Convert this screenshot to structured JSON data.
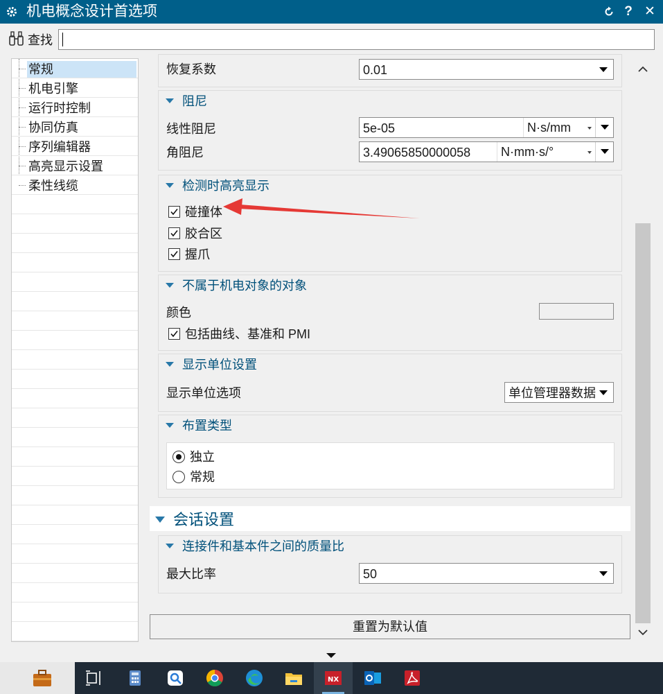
{
  "window": {
    "title": "机电概念设计首选项",
    "icons": [
      "gear-icon",
      "reset-icon",
      "help-icon",
      "close-icon"
    ],
    "help_label": "?",
    "close_label": "✕"
  },
  "search": {
    "label": "查找",
    "value": ""
  },
  "tree": {
    "items": [
      {
        "label": "常规",
        "selected": true
      },
      {
        "label": "机电引擎"
      },
      {
        "label": "运行时控制"
      },
      {
        "label": "协同仿真"
      },
      {
        "label": "序列编辑器"
      },
      {
        "label": "高亮显示设置"
      },
      {
        "label": "柔性线缆"
      }
    ]
  },
  "general": {
    "restitution": {
      "label": "恢复系数",
      "value": "0.01"
    },
    "damping": {
      "title": "阻尼",
      "linear": {
        "label": "线性阻尼",
        "value": "5e-05",
        "unit": "N·s/mm"
      },
      "angular": {
        "label": "角阻尼",
        "value": "3.49065850000058",
        "unit": "N·mm·s/°"
      }
    },
    "highlight": {
      "title": "检测时高亮显示",
      "items": [
        {
          "label": "碰撞体",
          "checked": true
        },
        {
          "label": "胶合区",
          "checked": true
        },
        {
          "label": "握爪",
          "checked": true
        }
      ]
    },
    "non_mechatronic": {
      "title": "不属于机电对象的对象",
      "color_label": "颜色",
      "include_label": "包括曲线、基准和 PMI",
      "include_checked": true
    },
    "unit_settings": {
      "title": "显示单位设置",
      "option_label": "显示单位选项",
      "option_value": "单位管理器数据"
    },
    "layout": {
      "title": "布置类型",
      "options": [
        {
          "label": "独立",
          "selected": true
        },
        {
          "label": "常规",
          "selected": false
        }
      ]
    }
  },
  "session": {
    "title": "会话设置",
    "mass_ratio": {
      "title": "连接件和基本件之间的质量比",
      "max_label": "最大比率",
      "max_value": "50"
    }
  },
  "buttons": {
    "reset": "重置为默认值"
  },
  "taskbar": {
    "apps": [
      "briefcase-icon",
      "task-view-icon",
      "calculator-icon",
      "snipping-icon",
      "chrome-icon",
      "edge-icon",
      "file-explorer-icon",
      "nx-icon",
      "outlook-icon",
      "acrobat-icon"
    ],
    "nx_label": "NX",
    "active": "nx-icon"
  },
  "colors": {
    "titlebar": "#005f8a",
    "group_header": "#00507a",
    "tree_selection": "#cce4f7",
    "annotation_arrow": "#e53935"
  }
}
